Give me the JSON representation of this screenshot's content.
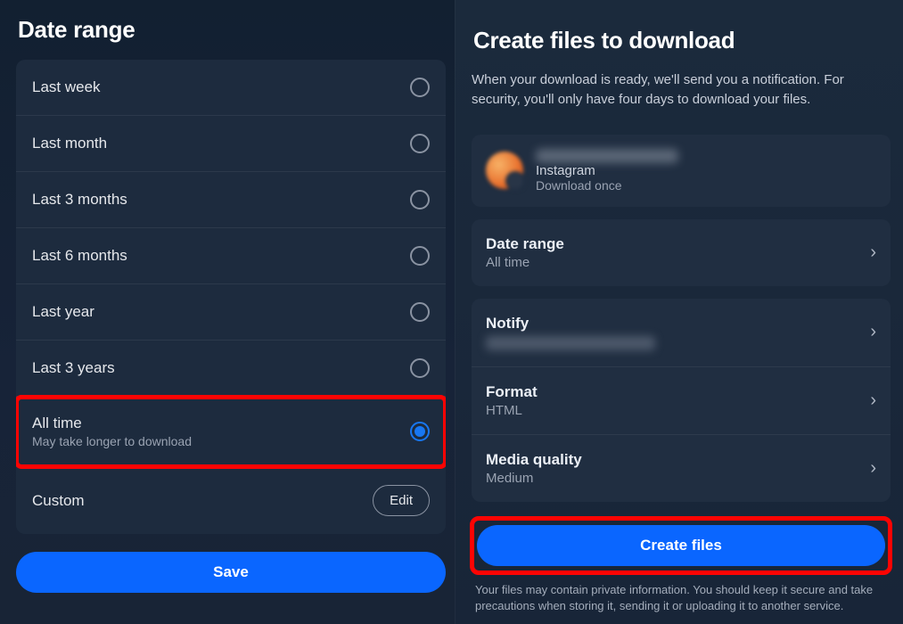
{
  "left": {
    "title": "Date range",
    "options": [
      {
        "label": "Last week"
      },
      {
        "label": "Last month"
      },
      {
        "label": "Last 3 months"
      },
      {
        "label": "Last 6 months"
      },
      {
        "label": "Last year"
      },
      {
        "label": "Last 3 years"
      },
      {
        "label": "All time",
        "sublabel": "May take longer to download",
        "selected": true
      },
      {
        "label": "Custom",
        "edit": "Edit"
      }
    ],
    "save": "Save"
  },
  "right": {
    "title": "Create files to download",
    "desc": "When your download is ready, we'll send you a notification. For security, you'll only have four days to download your files.",
    "account": {
      "platform": "Instagram",
      "frequency": "Download once"
    },
    "daterange": {
      "label": "Date range",
      "value": "All time"
    },
    "notify": {
      "label": "Notify"
    },
    "format": {
      "label": "Format",
      "value": "HTML"
    },
    "media": {
      "label": "Media quality",
      "value": "Medium"
    },
    "create": "Create files",
    "foot": "Your files may contain private information. You should keep it secure and take precautions when storing it, sending it or uploading it to another service."
  }
}
